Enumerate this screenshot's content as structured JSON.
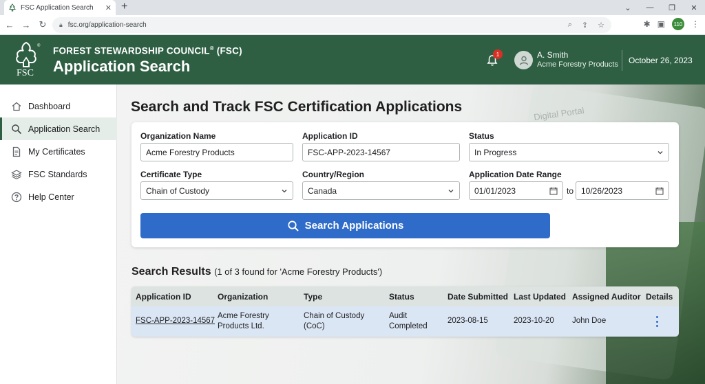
{
  "browser": {
    "tab_title": "FSC Application Search",
    "tab_close": "✕",
    "new_tab": "+",
    "url": "fsc.org/application-search",
    "profile_initials": "110"
  },
  "header": {
    "org_name": "FOREST STEWARDSHIP COUNCIL",
    "org_suffix": "(FSC)",
    "registered_mark": "®",
    "title": "Application Search",
    "logo_text": "FSC",
    "notification_count": "1",
    "user_name": "A. Smith",
    "user_org": "Acme Forestry Products",
    "date": "October 26, 2023"
  },
  "sidebar": {
    "items": [
      {
        "label": "Dashboard",
        "icon": "home-icon"
      },
      {
        "label": "Application Search",
        "icon": "search-icon",
        "active": true
      },
      {
        "label": "My Certificates",
        "icon": "document-icon"
      },
      {
        "label": "FSC Standards",
        "icon": "layers-icon"
      },
      {
        "label": "Help Center",
        "icon": "help-icon"
      }
    ]
  },
  "main": {
    "title": "Search and Track FSC Certification Applications",
    "decorative_text": "Digital Portal",
    "form": {
      "org_label": "Organization Name",
      "org_value": "Acme Forestry Products",
      "appid_label": "Application ID",
      "appid_value": "FSC-APP-2023-14567",
      "status_label": "Status",
      "status_value": "In Progress",
      "cert_label": "Certificate Type",
      "cert_value": "Chain of Custody",
      "country_label": "Country/Region",
      "country_value": "Canada",
      "date_label": "Application Date Range",
      "date_from": "01/01/2023",
      "date_to_word": "to",
      "date_to": "10/26/2023",
      "search_button": "Search Applications"
    },
    "results": {
      "title": "Search Results",
      "count_text": "(1 of 3 found for 'Acme Forestry Products')",
      "columns": [
        "Application ID",
        "Organization",
        "Type",
        "Status",
        "Date Submitted",
        "Last Updated",
        "Assigned Auditor",
        "Details"
      ],
      "rows": [
        {
          "app_id": "FSC-APP-2023-14567",
          "org_line1": "Acme Forestry",
          "org_line2": "Products Ltd.",
          "type_line1": "Chain of Custody",
          "type_line2": "(CoC)",
          "status_line1": "Audit",
          "status_line2": "Completed",
          "submitted": "2023-08-15",
          "updated": "2023-10-20",
          "auditor": "John Doe"
        }
      ]
    }
  },
  "colors": {
    "brand_green": "#2e5f43",
    "primary_blue": "#2f6bc8",
    "row_highlight": "#dbe6f5",
    "badge_red": "#d93025"
  }
}
